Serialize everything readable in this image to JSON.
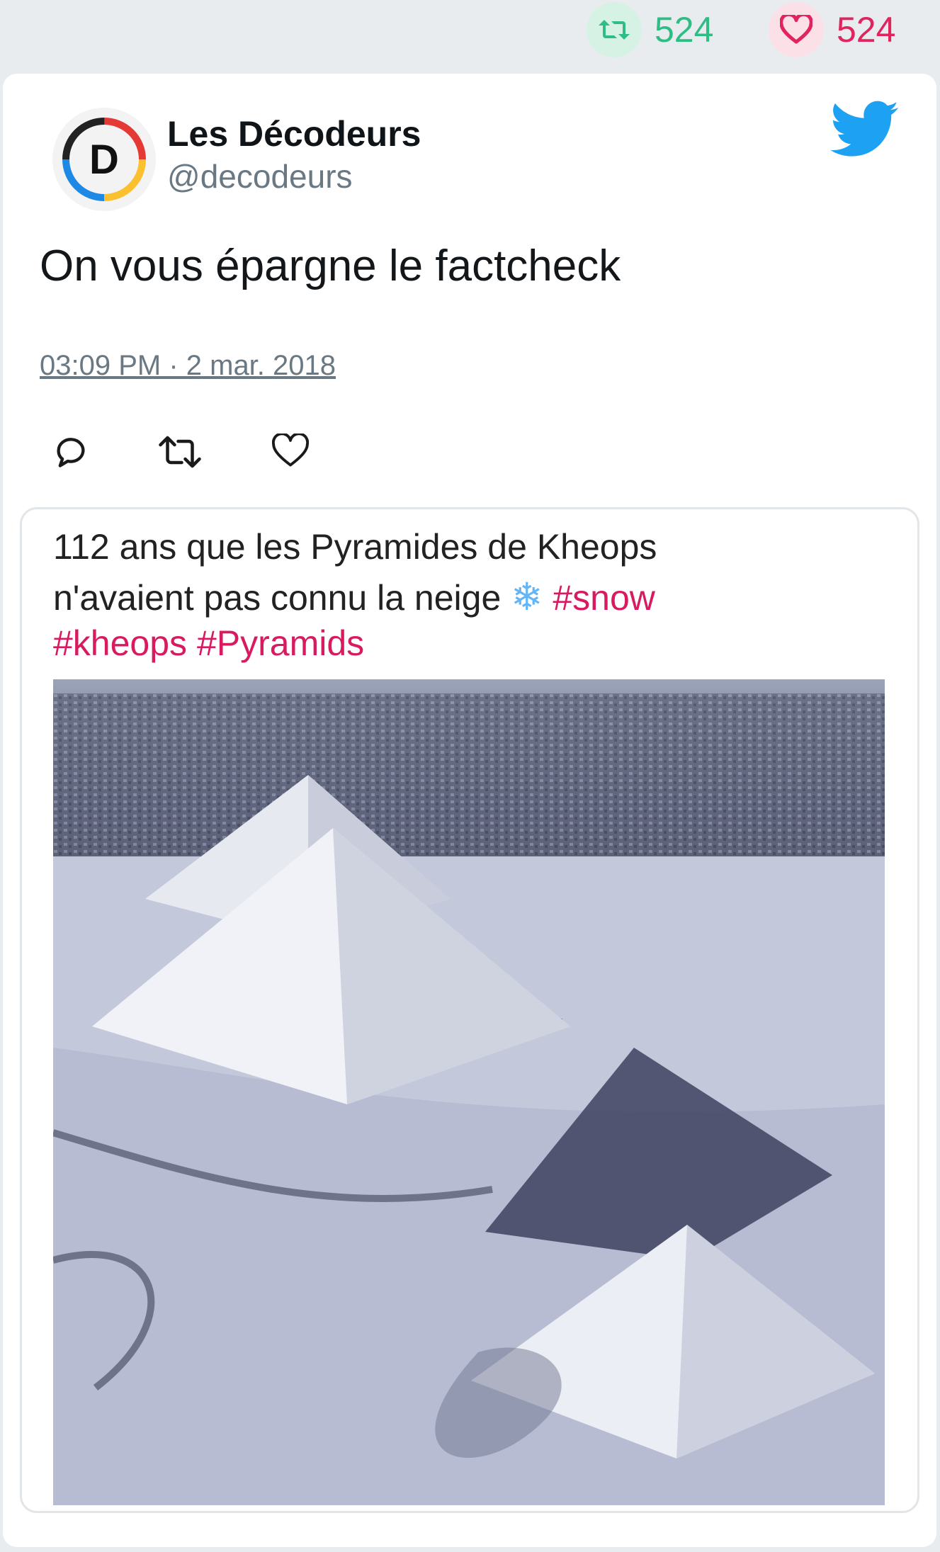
{
  "stats": {
    "retweets": "524",
    "likes": "524"
  },
  "tweet": {
    "author_name": "Les Décodeurs",
    "author_handle": "@decodeurs",
    "avatar_letter": "D",
    "text": "On vous épargne le factcheck",
    "timestamp": "03:09 PM · 2 mar. 2018"
  },
  "embed": {
    "line1": "112 ans que les Pyramides de Kheops",
    "line2_text": "n'avaient pas connu la neige",
    "line2_emoji": "❄",
    "hashtag_snow": "#snow",
    "hashtag_kheops": "#kheops",
    "hashtag_pyramids": "#Pyramids"
  },
  "colors": {
    "retweet_green": "#2fbd86",
    "like_red": "#e0245e",
    "twitter_blue": "#1da1f2",
    "hashtag_pink": "#d81b60"
  },
  "icons": [
    "retweet-icon",
    "heart-icon",
    "twitter-bird-icon",
    "reply-icon",
    "snowflake-icon"
  ]
}
